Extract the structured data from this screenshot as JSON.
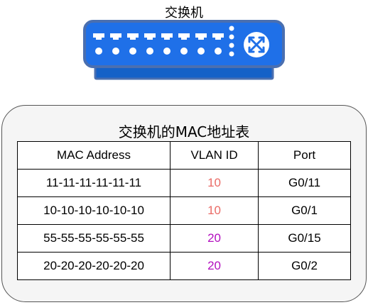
{
  "switch": {
    "label": "交换机",
    "icon": "network-switch-icon"
  },
  "table": {
    "title": "交换机的MAC地址表",
    "headers": {
      "mac": "MAC Address",
      "vlan": "VLAN ID",
      "port": "Port"
    },
    "rows": [
      {
        "mac": "11-11-11-11-11-11",
        "vlan": "10",
        "port": "G0/11"
      },
      {
        "mac": "10-10-10-10-10-10",
        "vlan": "10",
        "port": "G0/1"
      },
      {
        "mac": "55-55-55-55-55-55",
        "vlan": "20",
        "port": "G0/15"
      },
      {
        "mac": "20-20-20-20-20-20",
        "vlan": "20",
        "port": "G0/2"
      }
    ]
  },
  "colors": {
    "header_vlan": "#1f7fe0",
    "vlan": {
      "10": "#ea6b66",
      "20": "#b30fbf"
    },
    "switch_body": "#1f70e8",
    "switch_outline": "#4a6fb0"
  }
}
